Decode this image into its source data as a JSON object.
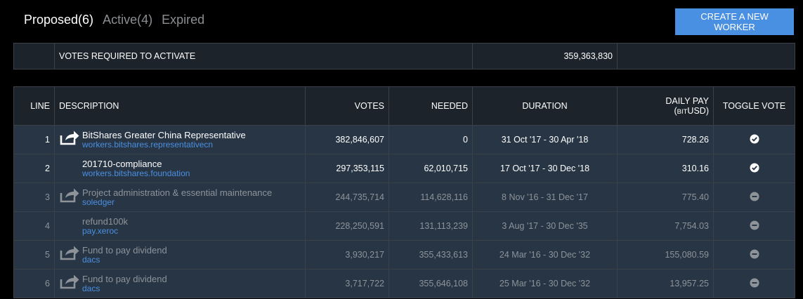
{
  "tabs": [
    {
      "label": "Proposed(6)",
      "active": true
    },
    {
      "label": "Active(4)",
      "active": false
    },
    {
      "label": "Expired",
      "active": false
    }
  ],
  "create_button_label": "CREATE A NEW WORKER",
  "votes_required": {
    "label": "VOTES REQUIRED TO ACTIVATE",
    "value": "359,363,830"
  },
  "columns": {
    "line": "LINE",
    "description": "DESCRIPTION",
    "votes": "VOTES",
    "needed": "NEEDED",
    "duration": "DURATION",
    "daily_pay": "DAILY PAY",
    "daily_pay_unit_prefix": "BIT",
    "daily_pay_unit": "USD",
    "toggle_vote": "TOGGLE VOTE"
  },
  "workers": [
    {
      "line": "1",
      "name": "BitShares Greater China Representative",
      "link": "workers.bitshares.representativecn",
      "votes": "382,846,607",
      "needed": "0",
      "duration": "31 Oct '17 - 30 Apr '18",
      "daily_pay": "728.26",
      "has_icon": true,
      "voted": true
    },
    {
      "line": "2",
      "name": "201710-compliance",
      "link": "workers.bitshares.foundation",
      "votes": "297,353,115",
      "needed": "62,010,715",
      "duration": "17 Oct '17 - 30 Dec '18",
      "daily_pay": "310.16",
      "has_icon": false,
      "voted": true
    },
    {
      "line": "3",
      "name": "Project administration & essential maintenance",
      "link": "soledger",
      "votes": "244,735,714",
      "needed": "114,628,116",
      "duration": "8 Nov '16 - 31 Dec '17",
      "daily_pay": "775.40",
      "has_icon": true,
      "voted": false
    },
    {
      "line": "4",
      "name": "refund100k",
      "link": "pay.xeroc",
      "votes": "228,250,591",
      "needed": "131,113,239",
      "duration": "3 Aug '17 - 30 Dec '35",
      "daily_pay": "7,754.03",
      "has_icon": false,
      "voted": false
    },
    {
      "line": "5",
      "name": "Fund to pay dividend",
      "link": "dacs",
      "votes": "3,930,217",
      "needed": "355,433,613",
      "duration": "24 Mar '16 - 30 Dec '32",
      "daily_pay": "155,080.59",
      "has_icon": true,
      "voted": false
    },
    {
      "line": "6",
      "name": "Fund to pay dividend",
      "link": "dacs",
      "votes": "3,717,722",
      "needed": "355,646,108",
      "duration": "25 Mar '16 - 30 Dec '32",
      "daily_pay": "13,957.25",
      "has_icon": true,
      "voted": false
    }
  ],
  "icons": {
    "worker_icon": "share-arrow-icon",
    "voted_icon": "check-circle-icon",
    "unvoted_icon": "minus-circle-icon"
  }
}
